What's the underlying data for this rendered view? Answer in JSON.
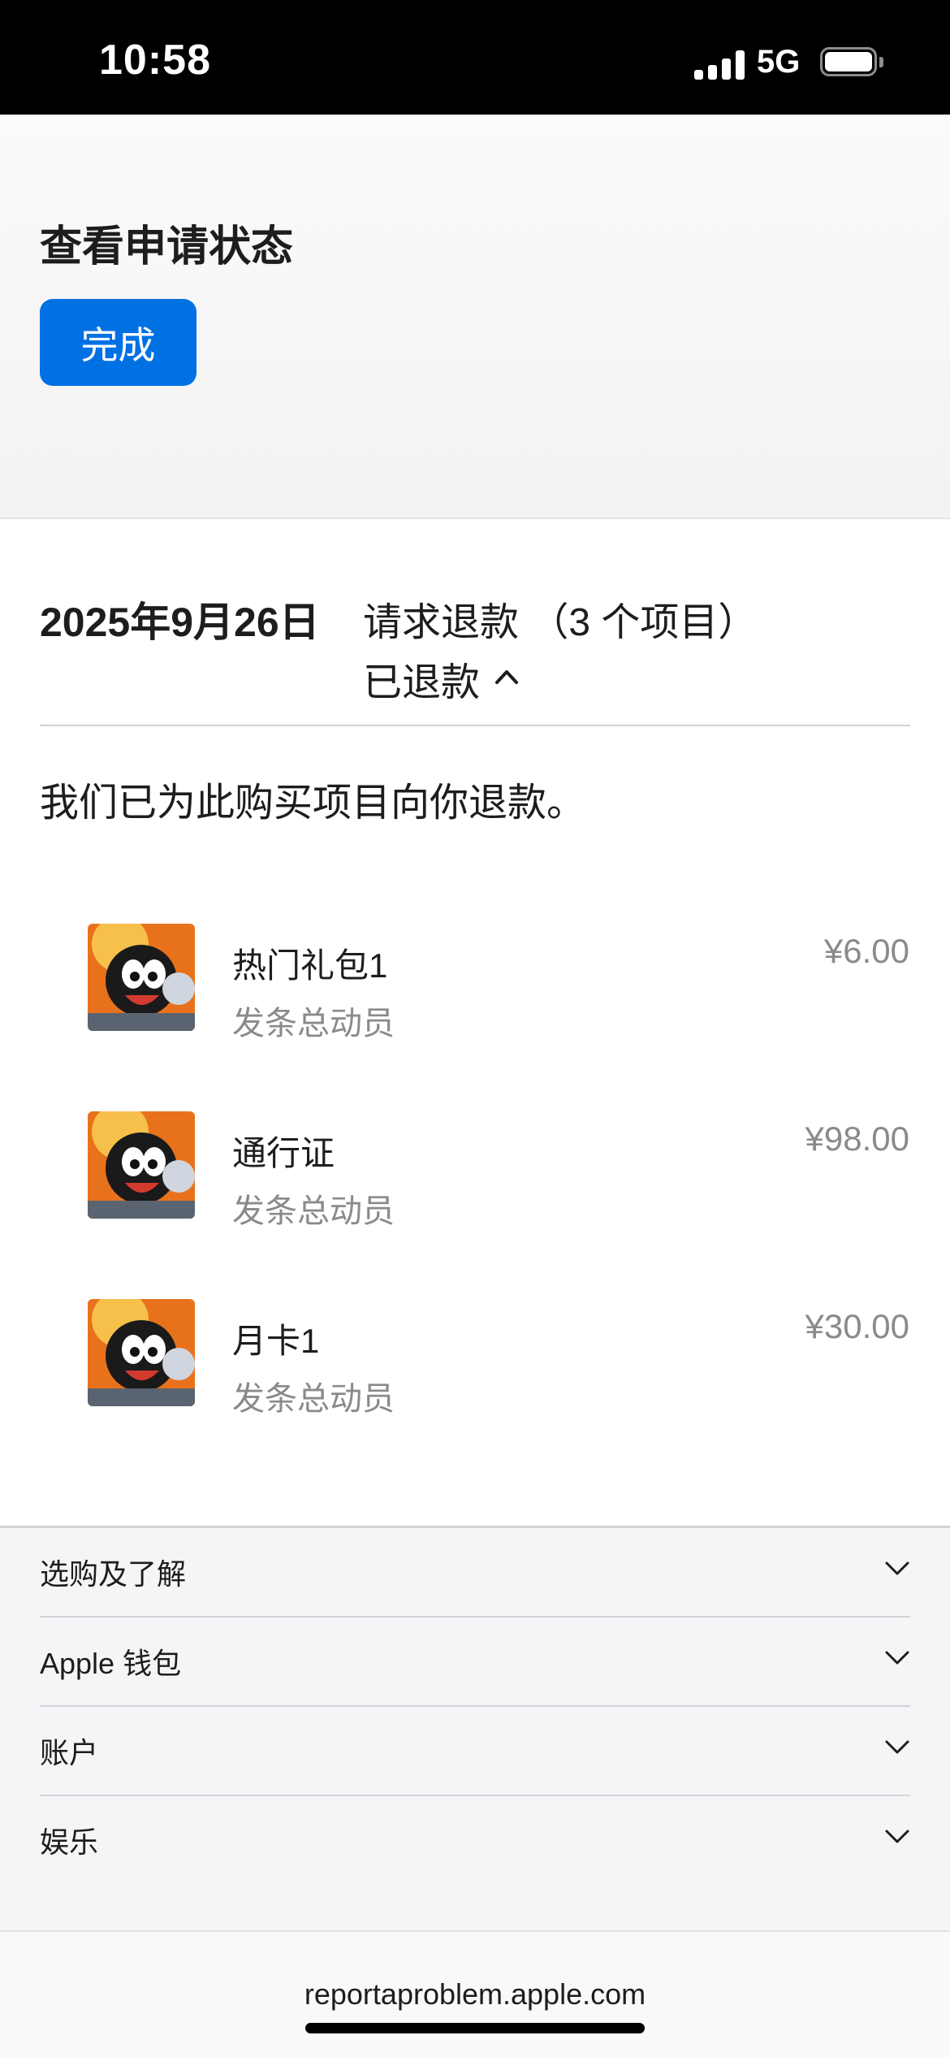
{
  "status_bar": {
    "time": "10:58",
    "network": "5G",
    "icons": [
      "signal-icon",
      "battery-icon"
    ]
  },
  "header": {
    "title": "查看申请状态",
    "done_label": "完成",
    "accent_color": "#0071e3"
  },
  "request": {
    "date": "2025年9月26日",
    "title": "请求退款 （3 个项目）",
    "status": "已退款",
    "message": "我们已为此购买项目向你退款。"
  },
  "items": [
    {
      "name": "热门礼包1",
      "app": "发条总动员",
      "price": "¥6.00",
      "icon": "game-app-icon"
    },
    {
      "name": "通行证",
      "app": "发条总动员",
      "price": "¥98.00",
      "icon": "game-app-icon"
    },
    {
      "name": "月卡1",
      "app": "发条总动员",
      "price": "¥30.00",
      "icon": "game-app-icon"
    }
  ],
  "footer": {
    "links": [
      "选购及了解",
      "Apple 钱包",
      "账户",
      "娱乐"
    ]
  },
  "browser": {
    "url": "reportaproblem.apple.com"
  }
}
